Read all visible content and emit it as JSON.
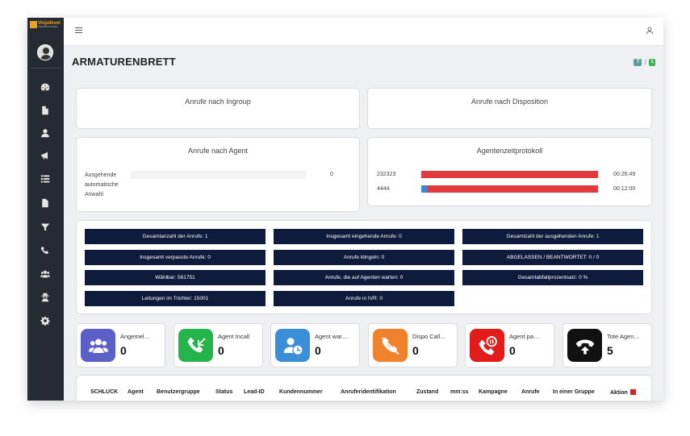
{
  "brand": {
    "name": "Voipdevel",
    "sub": "TECHNOLOGIES"
  },
  "colors": {
    "sidebar": "#262a33",
    "stat_box": "#0f1b3d",
    "progress_red": "#e23b3f",
    "progress_blue": "#3d87d6",
    "tile_logged_in": "#5b5fc7",
    "tile_incall": "#24b44a",
    "tile_waiting": "#3b8ed8",
    "tile_dispo": "#f0822e",
    "tile_paused": "#e21b1b",
    "tile_dead": "#111111"
  },
  "sidebar": {
    "icons": [
      "dashboard-icon",
      "file-icon",
      "user-icon",
      "megaphone-icon",
      "list-icon",
      "document-icon",
      "filter-icon",
      "phone-icon",
      "users-icon",
      "user-secret-icon",
      "gear-icon"
    ]
  },
  "header": {
    "title": "ARMATURENBRETT",
    "breadcrumb_sep": "/",
    "bc1": "T",
    "bc2": "1"
  },
  "cards": {
    "ingroup_title": "Anrufe nach Ingroup",
    "disposition_title": "Anrufe nach Disposition",
    "agent_title": "Anrufe nach Agent",
    "agent_rows": [
      {
        "label": "Ausgehende automatische Anwahl",
        "value": "0"
      }
    ],
    "timelog_title": "Agentenzeitprotokoll",
    "timelog_rows": [
      {
        "agent": "232323",
        "time": "00:26:49",
        "red_fraction": 1.0,
        "blue_fraction": 0
      },
      {
        "agent": "4444",
        "time": "00:12:00",
        "red_fraction": 0.97,
        "blue_fraction": 0.03
      }
    ]
  },
  "stats": [
    "Gesamtanzahl der Anrufe: 1",
    "Insgesamt eingehende Anrufe: 0",
    "Gesamtzahl der ausgehenden Anrufe: 1",
    "Insgesamt verpasste Anrufe: 0",
    "Anrufe klingeln: 0",
    "ABGELASSEN / BEANTWORTET: 0 / 0",
    "Wählbar: 561751",
    "Anrufe, die auf Agenten warten: 0",
    "Gesamtabfallprozentsatz: 0 %",
    "Leitungen im Trichter: 15001",
    "Anrufe in IVR: 0"
  ],
  "tiles": [
    {
      "label": "Angemel…",
      "value": "0",
      "icon": "users-icon"
    },
    {
      "label": "Agent Incall",
      "value": "0",
      "icon": "phone-incall-icon"
    },
    {
      "label": "Agent war…",
      "value": "0",
      "icon": "user-clock-icon"
    },
    {
      "label": "Dispo Call…",
      "value": "0",
      "icon": "phone-slash-icon"
    },
    {
      "label": "Agent pa…",
      "value": "0",
      "icon": "phone-pause-icon"
    },
    {
      "label": "Tote Agen…",
      "value": "5",
      "icon": "phone-hangup-icon"
    }
  ],
  "table": {
    "columns": [
      "SCHLUCK",
      "Agent",
      "Benutzergruppe",
      "Status",
      "Lead-ID",
      "Kundennummer",
      "Anruferidentifikation",
      "Zustand",
      "mm:ss",
      "Kampagne",
      "Anrufe",
      "In einer Gruppe",
      "Aktion"
    ]
  }
}
